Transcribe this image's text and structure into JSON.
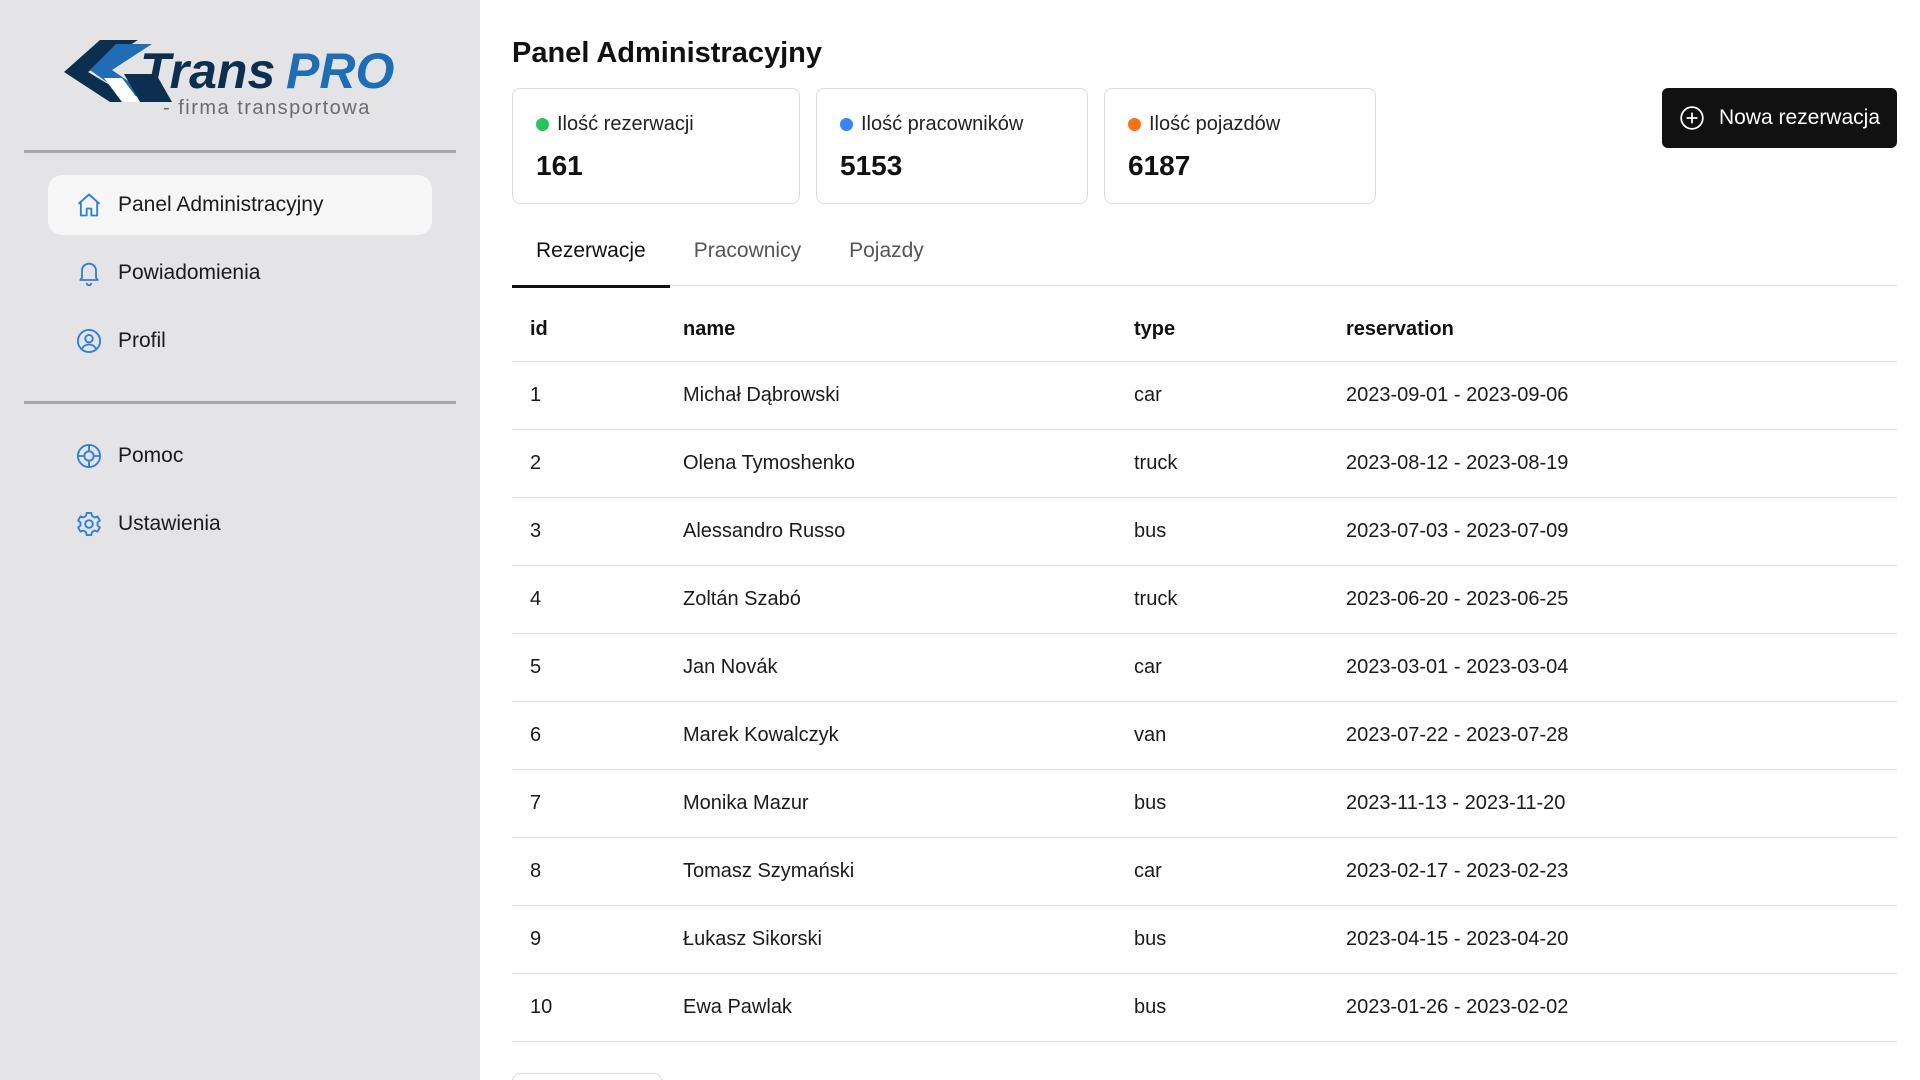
{
  "brand": {
    "name_part1": "Trans",
    "name_part2": "PRO",
    "tagline": "- firma transportowa",
    "color_primary": "#1f6db5",
    "color_dark": "#0d2f4f"
  },
  "sidebar": {
    "primary_items": [
      {
        "label": "Panel Administracyjny",
        "icon": "home-icon",
        "active": true
      },
      {
        "label": "Powiadomienia",
        "icon": "bell-icon",
        "active": false
      },
      {
        "label": "Profil",
        "icon": "user-circle-icon",
        "active": false
      }
    ],
    "secondary_items": [
      {
        "label": "Pomoc",
        "icon": "help-globe-icon"
      },
      {
        "label": "Ustawienia",
        "icon": "gear-icon"
      }
    ]
  },
  "page": {
    "title": "Panel Administracyjny"
  },
  "stats": [
    {
      "label": "Ilość rezerwacji",
      "value": "161",
      "dot_color": "#22c55e"
    },
    {
      "label": "Ilość pracowników",
      "value": "5153",
      "dot_color": "#3b82f6"
    },
    {
      "label": "Ilość pojazdów",
      "value": "6187",
      "dot_color": "#f97316"
    }
  ],
  "actions": {
    "new_reservation": "Nowa rezerwacja"
  },
  "tabs": [
    {
      "label": "Rezerwacje",
      "active": true
    },
    {
      "label": "Pracownicy",
      "active": false
    },
    {
      "label": "Pojazdy",
      "active": false
    }
  ],
  "table": {
    "columns": [
      "id",
      "name",
      "type",
      "reservation"
    ],
    "rows": [
      [
        "1",
        "Michał Dąbrowski",
        "car",
        "2023-09-01 - 2023-09-06"
      ],
      [
        "2",
        "Olena Tymoshenko",
        "truck",
        "2023-08-12 - 2023-08-19"
      ],
      [
        "3",
        "Alessandro Russo",
        "bus",
        "2023-07-03 - 2023-07-09"
      ],
      [
        "4",
        "Zoltán Szabó",
        "truck",
        "2023-06-20 - 2023-06-25"
      ],
      [
        "5",
        "Jan Novák",
        "car",
        "2023-03-01 - 2023-03-04"
      ],
      [
        "6",
        "Marek Kowalczyk",
        "van",
        "2023-07-22 - 2023-07-28"
      ],
      [
        "7",
        "Monika Mazur",
        "bus",
        "2023-11-13 - 2023-11-20"
      ],
      [
        "8",
        "Tomasz Szymański",
        "car",
        "2023-02-17 - 2023-02-23"
      ],
      [
        "9",
        "Łukasz Sikorski",
        "bus",
        "2023-04-15 - 2023-04-20"
      ],
      [
        "10",
        "Ewa Pawlak",
        "bus",
        "2023-01-26 - 2023-02-02"
      ]
    ]
  }
}
